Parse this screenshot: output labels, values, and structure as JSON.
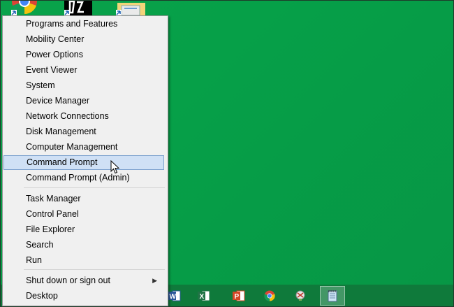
{
  "menu": {
    "items": [
      {
        "label": "Programs and Features"
      },
      {
        "label": "Mobility Center"
      },
      {
        "label": "Power Options"
      },
      {
        "label": "Event Viewer"
      },
      {
        "label": "System"
      },
      {
        "label": "Device Manager"
      },
      {
        "label": "Network Connections"
      },
      {
        "label": "Disk Management"
      },
      {
        "label": "Computer Management"
      },
      {
        "label": "Command Prompt",
        "highlighted": true
      },
      {
        "label": "Command Prompt (Admin)"
      },
      {
        "label": "Task Manager"
      },
      {
        "label": "Control Panel"
      },
      {
        "label": "File Explorer"
      },
      {
        "label": "Search"
      },
      {
        "label": "Run"
      },
      {
        "label": "Shut down or sign out",
        "has_submenu": true
      },
      {
        "label": "Desktop"
      }
    ]
  },
  "taskbar": {
    "pinned": [
      {
        "icon": "word-icon"
      },
      {
        "icon": "excel-icon"
      },
      {
        "icon": "powerpoint-icon"
      },
      {
        "icon": "chrome-icon"
      },
      {
        "icon": "snipping-tool-icon"
      },
      {
        "icon": "notepad-icon",
        "active": true
      }
    ]
  },
  "colors": {
    "desktop": "#079645",
    "menu_bg": "#f0f0f0",
    "highlight": "#cfe0f5",
    "highlight_border": "#7da2ce"
  }
}
